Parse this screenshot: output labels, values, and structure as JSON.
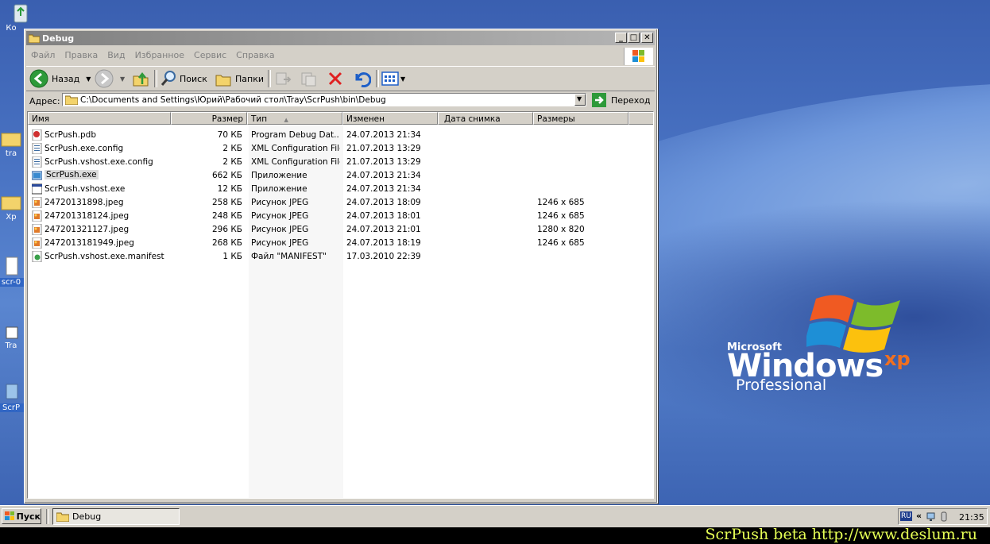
{
  "window": {
    "title": "Debug",
    "menu": [
      "Файл",
      "Правка",
      "Вид",
      "Избранное",
      "Сервис",
      "Справка"
    ],
    "toolbar": {
      "back_label": "Назад",
      "search_label": "Поиск",
      "folders_label": "Папки"
    },
    "address": {
      "label": "Адрес:",
      "value": "C:\\Documents and Settings\\Юрий\\Рабочий стол\\Tray\\ScrPush\\bin\\Debug",
      "go_label": "Переход"
    },
    "columns": [
      "Имя",
      "Размер",
      "Тип",
      "Изменен",
      "Дата снимка",
      "Размеры"
    ],
    "sorted_column": "Тип",
    "files": [
      {
        "name": "ScrPush.pdb",
        "size": "70 КБ",
        "type": "Program Debug Dat...",
        "modified": "24.07.2013 21:34",
        "photo_date": "",
        "dims": "",
        "icon": "pdb-file-icon"
      },
      {
        "name": "ScrPush.exe.config",
        "size": "2 КБ",
        "type": "XML Configuration File",
        "modified": "21.07.2013 13:29",
        "photo_date": "",
        "dims": "",
        "icon": "config-file-icon"
      },
      {
        "name": "ScrPush.vshost.exe.config",
        "size": "2 КБ",
        "type": "XML Configuration File",
        "modified": "21.07.2013 13:29",
        "photo_date": "",
        "dims": "",
        "icon": "config-file-icon"
      },
      {
        "name": "ScrPush.exe",
        "size": "662 КБ",
        "type": "Приложение",
        "modified": "24.07.2013 21:34",
        "photo_date": "",
        "dims": "",
        "icon": "application-icon",
        "selected": true
      },
      {
        "name": "ScrPush.vshost.exe",
        "size": "12 КБ",
        "type": "Приложение",
        "modified": "24.07.2013 21:34",
        "photo_date": "",
        "dims": "",
        "icon": "window-app-icon"
      },
      {
        "name": "24720131898.jpeg",
        "size": "258 КБ",
        "type": "Рисунок JPEG",
        "modified": "24.07.2013 18:09",
        "photo_date": "",
        "dims": "1246 x 685",
        "icon": "jpeg-file-icon"
      },
      {
        "name": "247201318124.jpeg",
        "size": "248 КБ",
        "type": "Рисунок JPEG",
        "modified": "24.07.2013 18:01",
        "photo_date": "",
        "dims": "1246 x 685",
        "icon": "jpeg-file-icon"
      },
      {
        "name": "247201321127.jpeg",
        "size": "296 КБ",
        "type": "Рисунок JPEG",
        "modified": "24.07.2013 21:01",
        "photo_date": "",
        "dims": "1280 x 820",
        "icon": "jpeg-file-icon"
      },
      {
        "name": "2472013181949.jpeg",
        "size": "268 КБ",
        "type": "Рисунок JPEG",
        "modified": "24.07.2013 18:19",
        "photo_date": "",
        "dims": "1246 x 685",
        "icon": "jpeg-file-icon"
      },
      {
        "name": "ScrPush.vshost.exe.manifest",
        "size": "1 КБ",
        "type": "Файл \"MANIFEST\"",
        "modified": "17.03.2010 22:39",
        "photo_date": "",
        "dims": "",
        "icon": "manifest-file-icon"
      }
    ]
  },
  "desktop": {
    "icons": [
      "Ко",
      "tra",
      "Хр",
      "scr-0",
      "Tra",
      "ScrP"
    ],
    "logo": {
      "microsoft": "Microsoft",
      "windows": "Windows",
      "xp": "xp",
      "edition": "Professional"
    }
  },
  "taskbar": {
    "start_label": "Пуск",
    "task_label": "Debug",
    "lang": "RU",
    "clock": "21:35"
  },
  "watermark": "ScrPush beta http://www.deslum.ru"
}
